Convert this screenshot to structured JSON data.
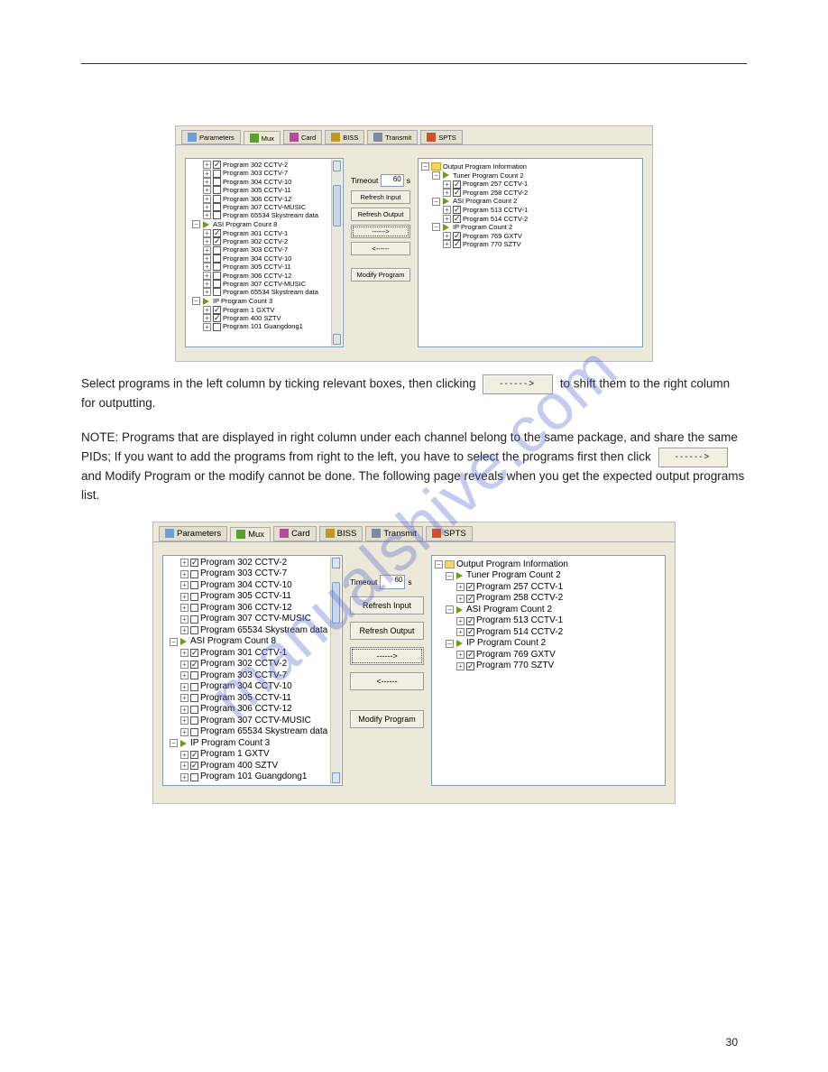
{
  "tabs": {
    "parameters": "Parameters",
    "mux": "Mux",
    "card": "Card",
    "biss": "BISS",
    "transmit": "Transmit",
    "spts": "SPTS"
  },
  "timeout_label": "Timeout",
  "timeout_value": "60",
  "timeout_unit": "s",
  "buttons": {
    "refresh_input": "Refresh Input",
    "refresh_output": "Refresh Output",
    "move_right": "------>",
    "move_left": "<------",
    "modify_program": "Modify Program"
  },
  "input_tree": {
    "top_programs": [
      {
        "checked": true,
        "label": "Program 302 CCTV-2"
      },
      {
        "checked": false,
        "label": "Program 303 CCTV-7"
      },
      {
        "checked": false,
        "label": "Program 304 CCTV-10"
      },
      {
        "checked": false,
        "label": "Program 305 CCTV-11"
      },
      {
        "checked": false,
        "label": "Program 306 CCTV-12"
      },
      {
        "checked": false,
        "label": "Program 307 CCTV-MUSIC"
      },
      {
        "checked": false,
        "label": "Program 65534 Skystream data"
      }
    ],
    "asi_header": "ASI  Program Count 8",
    "asi_programs": [
      {
        "checked": true,
        "label": "Program 301 CCTV-1"
      },
      {
        "checked": true,
        "label": "Program 302 CCTV-2"
      },
      {
        "checked": false,
        "label": "Program 303 CCTV-7"
      },
      {
        "checked": false,
        "label": "Program 304 CCTV-10"
      },
      {
        "checked": false,
        "label": "Program 305 CCTV-11"
      },
      {
        "checked": false,
        "label": "Program 306 CCTV-12"
      },
      {
        "checked": false,
        "label": "Program 307 CCTV-MUSIC"
      },
      {
        "checked": false,
        "label": "Program 65534 Skystream data"
      }
    ],
    "ip_header": "IP   Program Count 3",
    "ip_programs": [
      {
        "checked": true,
        "label": "Program 1 GXTV"
      },
      {
        "checked": true,
        "label": "Program 400 SZTV"
      },
      {
        "checked": false,
        "label": "Program 101 Guangdong1"
      }
    ]
  },
  "output_tree": {
    "root": "Output Program Information",
    "tuner_header": "Tuner Program Count 2",
    "tuner_programs": [
      {
        "checked": true,
        "label": "Program 257 CCTV-1"
      },
      {
        "checked": true,
        "label": "Program 258 CCTV-2"
      }
    ],
    "asi_header": "ASI  Program Count 2",
    "asi_programs": [
      {
        "checked": true,
        "label": "Program 513 CCTV-1"
      },
      {
        "checked": true,
        "label": "Program 514 CCTV-2"
      }
    ],
    "ip_header": "IP   Program Count 2",
    "ip_programs": [
      {
        "checked": true,
        "label": "Program 769 GXTV"
      },
      {
        "checked": true,
        "label": "Program 770 SZTV"
      }
    ]
  },
  "paragraphs": {
    "p1a": "Select programs in the left column by ticking relevant boxes, then clicking ",
    "p1b": " to shift them to the right column for outputting.",
    "p2a": "NOTE: Programs that are displayed in right column under each channel belong to the same package, and share the same PIDs; If you want to add the programs from right to the left, you have to select the programs first then click ",
    "p2b": " and ",
    "p2c": " or the modify cannot be done. The following page reveals when you get the expected output programs list."
  },
  "page_number": "30",
  "watermark": "manualshive.com"
}
